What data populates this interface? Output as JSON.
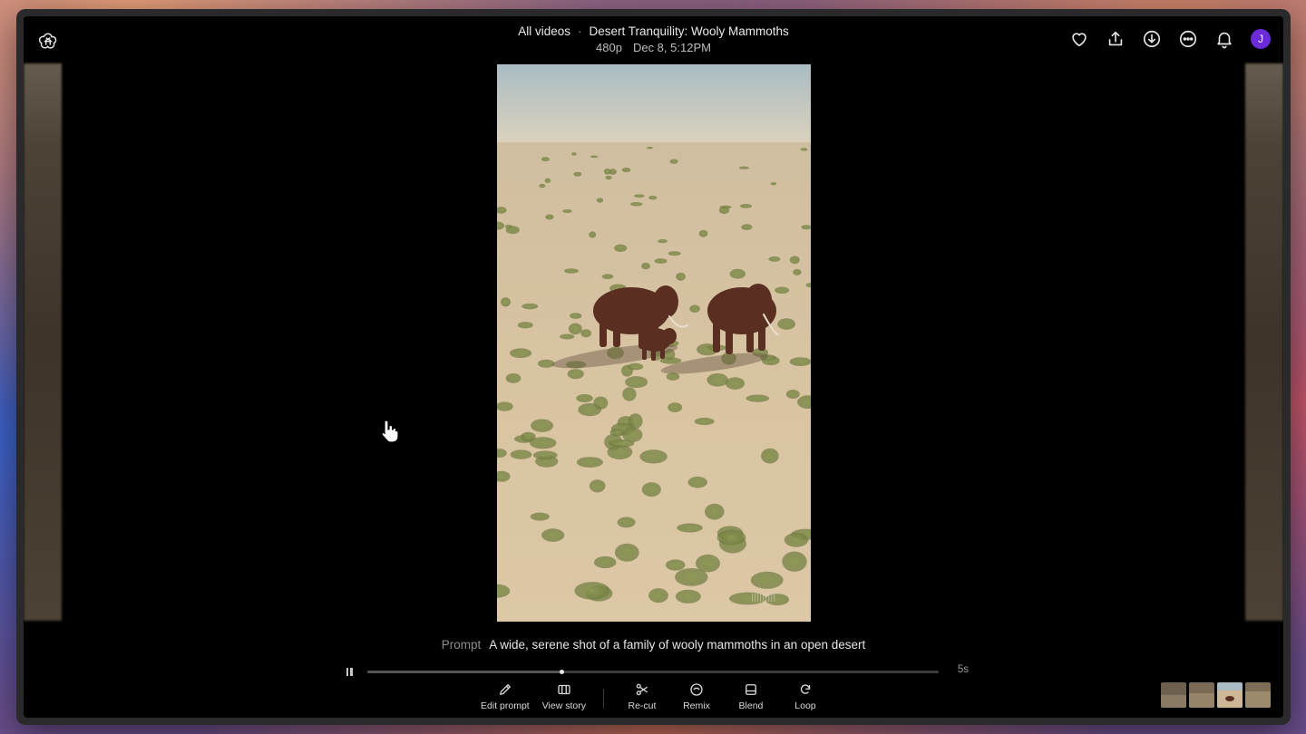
{
  "header": {
    "all_videos": "All videos",
    "separator": "·",
    "title": "Desert Tranquility: Wooly Mammoths",
    "resolution": "480p",
    "date": "Dec 8, 5:12PM"
  },
  "actions": {
    "avatar_initial": "J",
    "icons": [
      "heart-icon",
      "share-icon",
      "download-icon",
      "more-icon",
      "bell-icon"
    ]
  },
  "prompt": {
    "label": "Prompt",
    "text": "A wide, serene shot of a family of wooly mammoths in an open desert"
  },
  "player": {
    "duration": "5s",
    "progress": 0.34
  },
  "toolbar": {
    "edit_prompt": "Edit prompt",
    "view_story": "View story",
    "recut": "Re-cut",
    "remix": "Remix",
    "blend": "Blend",
    "loop": "Loop"
  },
  "colors": {
    "accent_avatar": "#6c2bd9",
    "background": "#000000"
  }
}
